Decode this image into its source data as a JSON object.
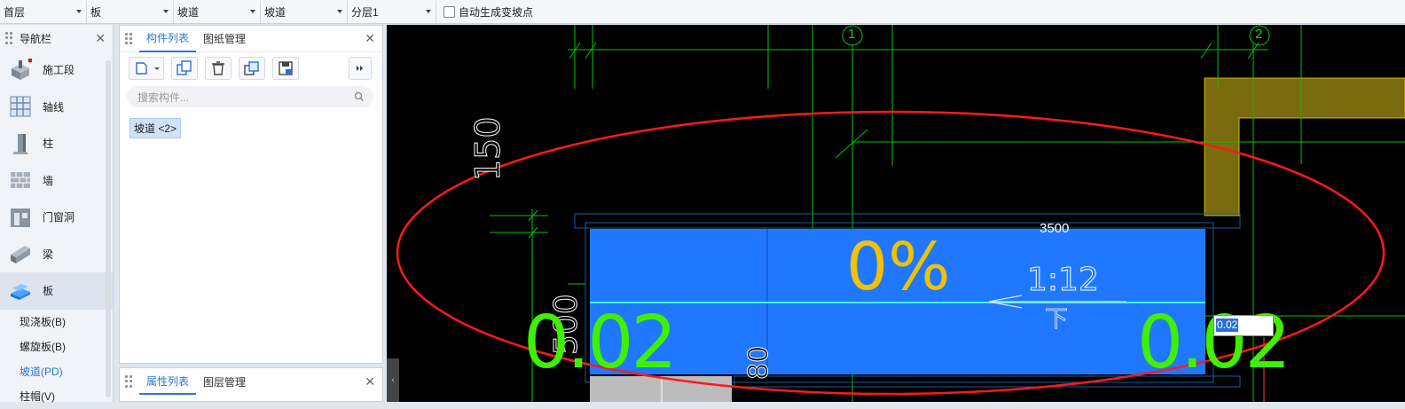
{
  "toolbar": {
    "floor": "首层",
    "category": "板",
    "type": "坡道",
    "component": "坡道",
    "layer": "分层1",
    "auto_slope_label": "自动生成变坡点"
  },
  "nav": {
    "title": "导航栏",
    "items": [
      {
        "label": "施工段",
        "icon": "construction-segment-icon"
      },
      {
        "label": "轴线",
        "icon": "grid-axis-icon"
      },
      {
        "label": "柱",
        "icon": "column-icon"
      },
      {
        "label": "墙",
        "icon": "wall-icon"
      },
      {
        "label": "门窗洞",
        "icon": "door-window-icon"
      },
      {
        "label": "梁",
        "icon": "beam-icon"
      },
      {
        "label": "板",
        "icon": "slab-icon"
      }
    ],
    "sub_items": [
      "现浇板(B)",
      "螺旋板(B)",
      "坡道(PD)",
      "柱帽(V)"
    ]
  },
  "component_list": {
    "tabs": [
      "构件列表",
      "图纸管理"
    ],
    "search_placeholder": "搜索构件...",
    "items": [
      "坡道 <2>"
    ]
  },
  "property_panel": {
    "tabs": [
      "属性列表",
      "图层管理"
    ]
  },
  "canvas": {
    "grid_labels": [
      "1",
      "2"
    ],
    "dim_top": "3500",
    "dim_left_1": "150",
    "dim_left_2": "500",
    "percent": "0%",
    "slope_ratio": "1:12",
    "down_label": "下",
    "elev_left": "0.02",
    "elev_right": "0.02",
    "input_value": "0.02",
    "dim_bottom": "80",
    "colors": {
      "slab": "#1f78ff",
      "axis": "#00c800",
      "percent_text": "#f2c200",
      "elev_text": "#40f000",
      "highlight_ellipse": "#ff1a1a",
      "column": "#7a6a10"
    }
  }
}
